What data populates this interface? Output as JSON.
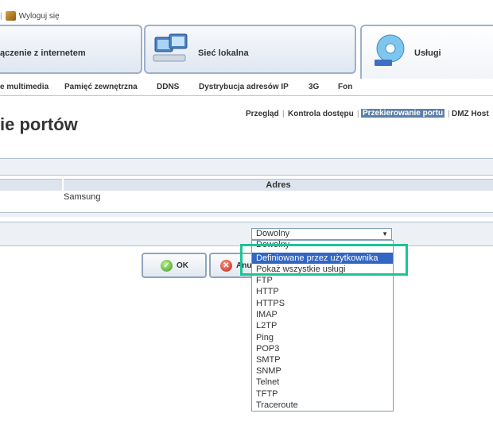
{
  "topbar": {
    "logout_label": "Wyloguj się"
  },
  "main_tabs": [
    {
      "label": "ączenie z internetem"
    },
    {
      "label": "Sieć lokalna"
    },
    {
      "label": "Usługi"
    }
  ],
  "subnav": [
    {
      "label": "e multimedia"
    },
    {
      "label": "Pamięć zewnętrzna"
    },
    {
      "label": "DDNS"
    },
    {
      "label": "Dystrybucja adresów IP"
    },
    {
      "label": "3G"
    },
    {
      "label": "Fon"
    }
  ],
  "right_links": [
    {
      "label": "Przegląd"
    },
    {
      "label": "Kontrola dostępu"
    },
    {
      "label": "Przekierowanie portu",
      "active": true
    },
    {
      "label": "DMZ Host"
    }
  ],
  "page_title": "ie portów",
  "table": {
    "column_header": "Adres",
    "rows": [
      {
        "address": "Samsung"
      }
    ]
  },
  "select": {
    "value": "Dowolny",
    "options": [
      "Dowolny",
      "Definiowane przez użytkownika",
      "Pokaż wszystkie usługi",
      "FTP",
      "HTTP",
      "HTTPS",
      "IMAP",
      "L2TP",
      "Ping",
      "POP3",
      "SMTP",
      "SNMP",
      "Telnet",
      "TFTP",
      "Traceroute"
    ],
    "highlighted_option": "Definiowane przez użytkownika"
  },
  "buttons": {
    "ok_label": "OK",
    "cancel_label": "Anuluj"
  },
  "colors": {
    "highlight_box": "#1cc494",
    "selected_option": "#3166c3",
    "tab_border": "#9fb1c8"
  }
}
